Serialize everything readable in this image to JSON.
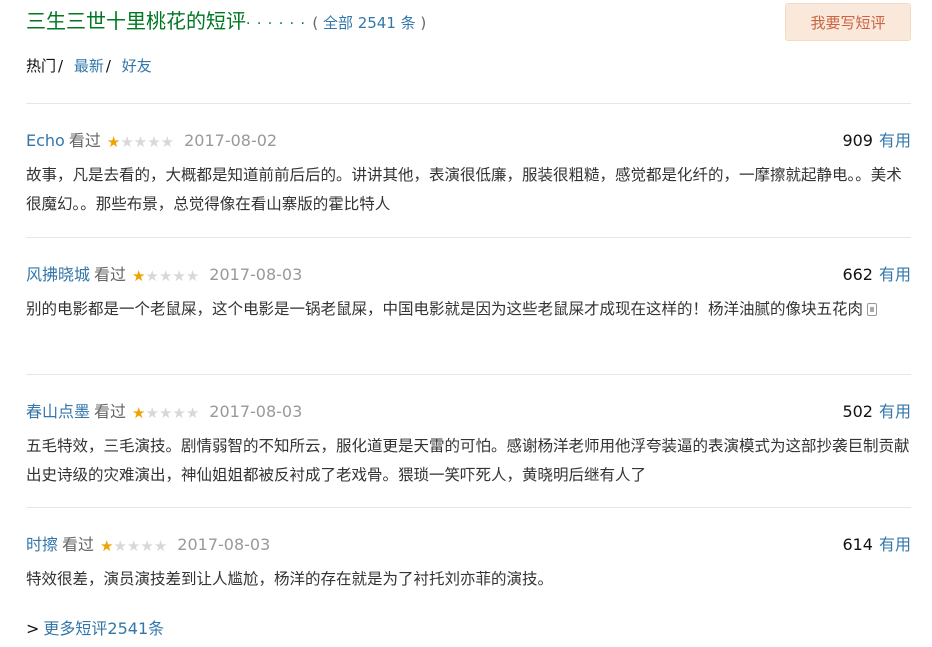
{
  "header": {
    "title": "三生三世十里桃花的短评",
    "dots": "· · · · · ·",
    "count_open": "( ",
    "count_link": "全部 2541 条",
    "count_close": " )",
    "write_button": "我要写短评"
  },
  "filters": {
    "hot": "热门",
    "latest": "最新",
    "friends": "好友",
    "separator": "/"
  },
  "comments": [
    {
      "user": "Echo",
      "status": "看过",
      "rating": 1,
      "date": "2017-08-02",
      "votes": "909",
      "useful_label": "有用",
      "text": "故事，凡是去看的，大概都是知道前前后后的。讲讲其他，表演很低廉，服装很粗糙，感觉都是化纤的，一摩擦就起静电。。美术很魔幻。。那些布景，总觉得像在看山寨版的霍比特人"
    },
    {
      "user": "风拂晓城",
      "status": "看过",
      "rating": 1,
      "date": "2017-08-03",
      "votes": "662",
      "useful_label": "有用",
      "text": "别的电影都是一个老鼠屎，这个电影是一锅老鼠屎，中国电影就是因为这些老鼠屎才成现在这样的！杨洋油腻的像块五花肉"
    },
    {
      "user": "春山点墨",
      "status": "看过",
      "rating": 1,
      "date": "2017-08-03",
      "votes": "502",
      "useful_label": "有用",
      "text": "五毛特效，三毛演技。剧情弱智的不知所云，服化道更是天雷的可怕。感谢杨洋老师用他浮夸装逼的表演模式为这部抄袭巨制贡献出史诗级的灾难演出，神仙姐姐都被反衬成了老戏骨。猥琐一笑吓死人，黄晓明后继有人了"
    },
    {
      "user": "时擦",
      "status": "看过",
      "rating": 1,
      "date": "2017-08-03",
      "votes": "614",
      "useful_label": "有用",
      "text": "特效很差，演员演技差到让人尴尬，杨洋的存在就是为了衬托刘亦菲的演技。"
    }
  ],
  "more": {
    "arrow": ">",
    "label": "更多短评2541条"
  }
}
